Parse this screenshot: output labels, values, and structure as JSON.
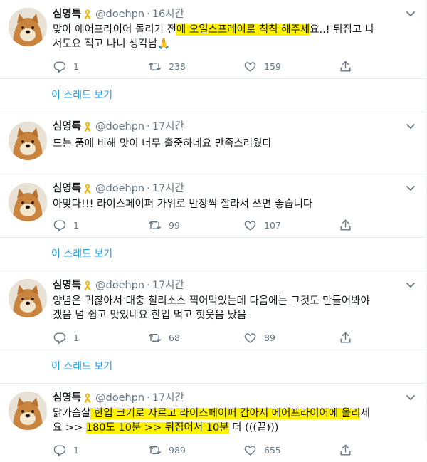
{
  "colors": {
    "link": "#1da1f2",
    "muted": "#657786",
    "highlight": "#fff200"
  },
  "tweets": [
    {
      "name": "심영특",
      "handle": "@doehpn",
      "time": "16시간",
      "text": {
        "p1": "맞아 에어프라이어 돌리기 전",
        "h1": "에 오일스프레이로 칙칙 해주세",
        "p2": "요..! 뒤집고 나",
        "line2": "서도요 적고 나니 생각남🙏"
      },
      "replies": "1",
      "retweets": "238",
      "likes": "159",
      "thread_link": "이 스레드 보기"
    },
    {
      "name": "심영특",
      "handle": "@doehpn",
      "time": "17시간",
      "text": {
        "p1": "드는 품에 비해 맛이 너무 출중하네요 만족스러웠다"
      }
    },
    {
      "name": "심영특",
      "handle": "@doehpn",
      "time": "17시간",
      "text": {
        "p1": "아맞다!!! 라이스페이퍼 가위로 반장씩 잘라서 쓰면 좋습니다"
      },
      "replies": "1",
      "retweets": "99",
      "likes": "107",
      "thread_link": "이 스레드 보기"
    },
    {
      "name": "심영특",
      "handle": "@doehpn",
      "time": "17시간",
      "text": {
        "line1": "양념은 귀찮아서 대충 칠리소스 찍어먹었는데 다음에는 그것도 만들어봐야",
        "line2": "겠음 넘 쉽고 맛있네요 한입 먹고 헛웃음 났음"
      },
      "replies": "1",
      "retweets": "68",
      "likes": "89",
      "thread_link": "이 스레드 보기"
    },
    {
      "name": "심영특",
      "handle": "@doehpn",
      "time": "17시간",
      "text": {
        "p1": "닭가슴살",
        "h1": " 한입 크기로 자르고 라이스페이퍼 감아서 에어프라이어에 올리",
        "p2": "세",
        "l2p1": "요 >> ",
        "h2": "180도 10분 >> 뒤집어서 10분",
        "l2p2": " 더 (((끝)))"
      },
      "replies": "1",
      "retweets": "989",
      "likes": "655"
    }
  ]
}
